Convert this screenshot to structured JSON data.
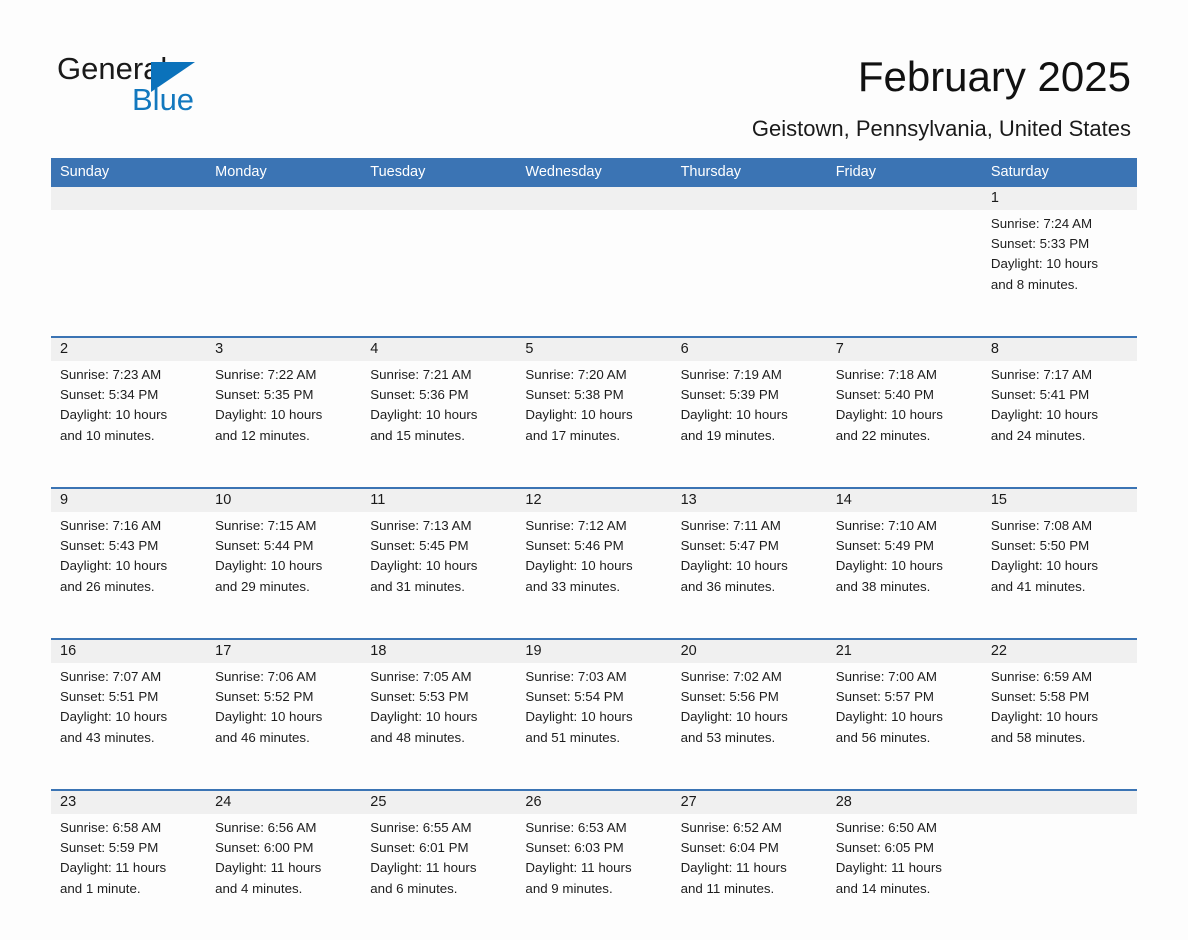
{
  "brand": {
    "name_part1": "General",
    "name_part2": "Blue",
    "triangle_color": "#0b72bb",
    "blue_text_color": "#1278be"
  },
  "header": {
    "title": "February 2025",
    "subtitle": "Geistown, Pennsylvania, United States"
  },
  "theme": {
    "header_blue": "#3b74b4",
    "row_rule_blue": "#3b74b4",
    "day_number_band": "#f0f0f0",
    "page_background": "#fdfdfd",
    "text_color": "#1a1a1a"
  },
  "weekday_headers": [
    "Sunday",
    "Monday",
    "Tuesday",
    "Wednesday",
    "Thursday",
    "Friday",
    "Saturday"
  ],
  "weeks": [
    [
      {
        "day": "",
        "lines": []
      },
      {
        "day": "",
        "lines": []
      },
      {
        "day": "",
        "lines": []
      },
      {
        "day": "",
        "lines": []
      },
      {
        "day": "",
        "lines": []
      },
      {
        "day": "",
        "lines": []
      },
      {
        "day": "1",
        "lines": [
          "Sunrise: 7:24 AM",
          "Sunset: 5:33 PM",
          "Daylight: 10 hours",
          "and 8 minutes."
        ]
      }
    ],
    [
      {
        "day": "2",
        "lines": [
          "Sunrise: 7:23 AM",
          "Sunset: 5:34 PM",
          "Daylight: 10 hours",
          "and 10 minutes."
        ]
      },
      {
        "day": "3",
        "lines": [
          "Sunrise: 7:22 AM",
          "Sunset: 5:35 PM",
          "Daylight: 10 hours",
          "and 12 minutes."
        ]
      },
      {
        "day": "4",
        "lines": [
          "Sunrise: 7:21 AM",
          "Sunset: 5:36 PM",
          "Daylight: 10 hours",
          "and 15 minutes."
        ]
      },
      {
        "day": "5",
        "lines": [
          "Sunrise: 7:20 AM",
          "Sunset: 5:38 PM",
          "Daylight: 10 hours",
          "and 17 minutes."
        ]
      },
      {
        "day": "6",
        "lines": [
          "Sunrise: 7:19 AM",
          "Sunset: 5:39 PM",
          "Daylight: 10 hours",
          "and 19 minutes."
        ]
      },
      {
        "day": "7",
        "lines": [
          "Sunrise: 7:18 AM",
          "Sunset: 5:40 PM",
          "Daylight: 10 hours",
          "and 22 minutes."
        ]
      },
      {
        "day": "8",
        "lines": [
          "Sunrise: 7:17 AM",
          "Sunset: 5:41 PM",
          "Daylight: 10 hours",
          "and 24 minutes."
        ]
      }
    ],
    [
      {
        "day": "9",
        "lines": [
          "Sunrise: 7:16 AM",
          "Sunset: 5:43 PM",
          "Daylight: 10 hours",
          "and 26 minutes."
        ]
      },
      {
        "day": "10",
        "lines": [
          "Sunrise: 7:15 AM",
          "Sunset: 5:44 PM",
          "Daylight: 10 hours",
          "and 29 minutes."
        ]
      },
      {
        "day": "11",
        "lines": [
          "Sunrise: 7:13 AM",
          "Sunset: 5:45 PM",
          "Daylight: 10 hours",
          "and 31 minutes."
        ]
      },
      {
        "day": "12",
        "lines": [
          "Sunrise: 7:12 AM",
          "Sunset: 5:46 PM",
          "Daylight: 10 hours",
          "and 33 minutes."
        ]
      },
      {
        "day": "13",
        "lines": [
          "Sunrise: 7:11 AM",
          "Sunset: 5:47 PM",
          "Daylight: 10 hours",
          "and 36 minutes."
        ]
      },
      {
        "day": "14",
        "lines": [
          "Sunrise: 7:10 AM",
          "Sunset: 5:49 PM",
          "Daylight: 10 hours",
          "and 38 minutes."
        ]
      },
      {
        "day": "15",
        "lines": [
          "Sunrise: 7:08 AM",
          "Sunset: 5:50 PM",
          "Daylight: 10 hours",
          "and 41 minutes."
        ]
      }
    ],
    [
      {
        "day": "16",
        "lines": [
          "Sunrise: 7:07 AM",
          "Sunset: 5:51 PM",
          "Daylight: 10 hours",
          "and 43 minutes."
        ]
      },
      {
        "day": "17",
        "lines": [
          "Sunrise: 7:06 AM",
          "Sunset: 5:52 PM",
          "Daylight: 10 hours",
          "and 46 minutes."
        ]
      },
      {
        "day": "18",
        "lines": [
          "Sunrise: 7:05 AM",
          "Sunset: 5:53 PM",
          "Daylight: 10 hours",
          "and 48 minutes."
        ]
      },
      {
        "day": "19",
        "lines": [
          "Sunrise: 7:03 AM",
          "Sunset: 5:54 PM",
          "Daylight: 10 hours",
          "and 51 minutes."
        ]
      },
      {
        "day": "20",
        "lines": [
          "Sunrise: 7:02 AM",
          "Sunset: 5:56 PM",
          "Daylight: 10 hours",
          "and 53 minutes."
        ]
      },
      {
        "day": "21",
        "lines": [
          "Sunrise: 7:00 AM",
          "Sunset: 5:57 PM",
          "Daylight: 10 hours",
          "and 56 minutes."
        ]
      },
      {
        "day": "22",
        "lines": [
          "Sunrise: 6:59 AM",
          "Sunset: 5:58 PM",
          "Daylight: 10 hours",
          "and 58 minutes."
        ]
      }
    ],
    [
      {
        "day": "23",
        "lines": [
          "Sunrise: 6:58 AM",
          "Sunset: 5:59 PM",
          "Daylight: 11 hours",
          "and 1 minute."
        ]
      },
      {
        "day": "24",
        "lines": [
          "Sunrise: 6:56 AM",
          "Sunset: 6:00 PM",
          "Daylight: 11 hours",
          "and 4 minutes."
        ]
      },
      {
        "day": "25",
        "lines": [
          "Sunrise: 6:55 AM",
          "Sunset: 6:01 PM",
          "Daylight: 11 hours",
          "and 6 minutes."
        ]
      },
      {
        "day": "26",
        "lines": [
          "Sunrise: 6:53 AM",
          "Sunset: 6:03 PM",
          "Daylight: 11 hours",
          "and 9 minutes."
        ]
      },
      {
        "day": "27",
        "lines": [
          "Sunrise: 6:52 AM",
          "Sunset: 6:04 PM",
          "Daylight: 11 hours",
          "and 11 minutes."
        ]
      },
      {
        "day": "28",
        "lines": [
          "Sunrise: 6:50 AM",
          "Sunset: 6:05 PM",
          "Daylight: 11 hours",
          "and 14 minutes."
        ]
      },
      {
        "day": "",
        "lines": []
      }
    ]
  ]
}
